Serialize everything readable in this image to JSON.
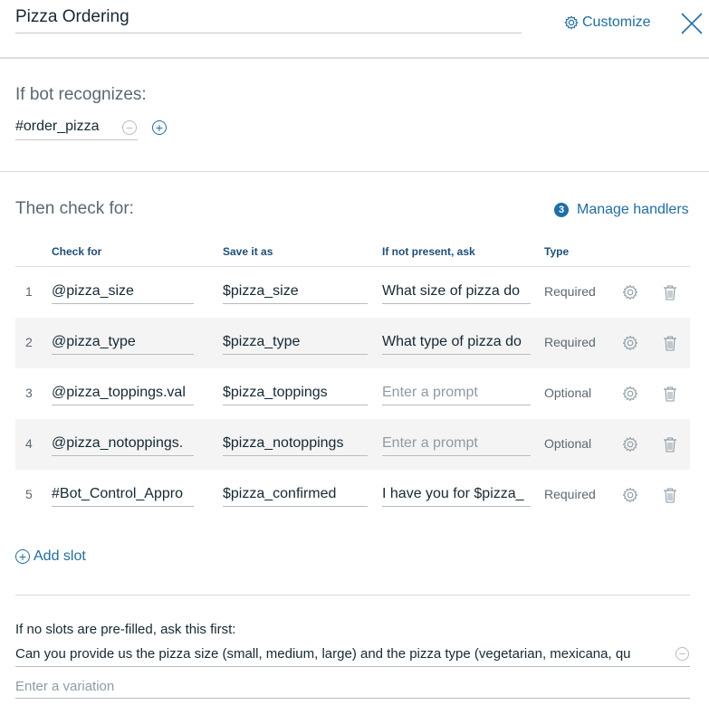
{
  "header": {
    "title": "Pizza Ordering",
    "customize_label": "Customize",
    "icons": {
      "customize": "gear-icon",
      "close": "close-icon"
    }
  },
  "recognizes": {
    "heading": "If bot recognizes:",
    "condition": "#order_pizza",
    "icons": {
      "remove": "minus-circle-icon",
      "add": "plus-circle-icon"
    }
  },
  "slots": {
    "heading": "Then check for:",
    "manage_handlers_count": "3",
    "manage_handlers_label": "Manage handlers",
    "columns": {
      "check_for": "Check for",
      "save_as": "Save it as",
      "ask": "If not present, ask",
      "type": "Type"
    },
    "rows": [
      {
        "num": "1",
        "check_for": "@pizza_size",
        "save_as": "$pizza_size",
        "prompt": "What size of pizza do",
        "prompt_is_placeholder": false,
        "type": "Required"
      },
      {
        "num": "2",
        "check_for": "@pizza_type",
        "save_as": "$pizza_type",
        "prompt": "What type of pizza do",
        "prompt_is_placeholder": false,
        "type": "Required"
      },
      {
        "num": "3",
        "check_for": "@pizza_toppings.val",
        "save_as": "$pizza_toppings",
        "prompt": "Enter a prompt",
        "prompt_is_placeholder": true,
        "type": "Optional"
      },
      {
        "num": "4",
        "check_for": "@pizza_notoppings.",
        "save_as": "$pizza_notoppings",
        "prompt": "Enter a prompt",
        "prompt_is_placeholder": true,
        "type": "Optional"
      },
      {
        "num": "5",
        "check_for": "#Bot_Control_Appro",
        "save_as": "$pizza_confirmed",
        "prompt": "I have you for $pizza_",
        "prompt_is_placeholder": false,
        "type": "Required"
      }
    ],
    "row_icons": {
      "settings": "gear-icon",
      "delete": "trash-icon"
    },
    "add_slot_label": "Add slot"
  },
  "prefill": {
    "label": "If no slots are pre-filled, ask this first:",
    "text": "Can you provide us the pizza size (small, medium, large) and the pizza type (vegetarian, mexicana, qu",
    "variation_placeholder": "Enter a variation"
  },
  "colors": {
    "accent": "#1d6ea8",
    "text": "#152935",
    "muted": "#5a6872",
    "placeholder": "#8c9ba5",
    "row_alt_bg": "#f4f4f4"
  }
}
